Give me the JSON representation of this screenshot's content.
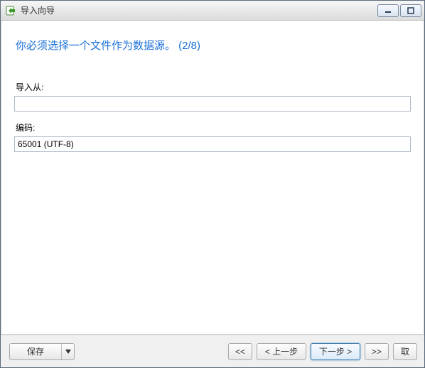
{
  "window": {
    "title": "导入向导"
  },
  "heading": "你必须选择一个文件作为数据源。 (2/8)",
  "import_from": {
    "label": "导入从:",
    "value": ""
  },
  "encoding": {
    "label": "编码:",
    "value": "65001 (UTF-8)"
  },
  "footer": {
    "save": "保存",
    "first": "<<",
    "prev": "< 上一步",
    "next": "下一步 >",
    "last": ">>",
    "cancel": "取"
  }
}
